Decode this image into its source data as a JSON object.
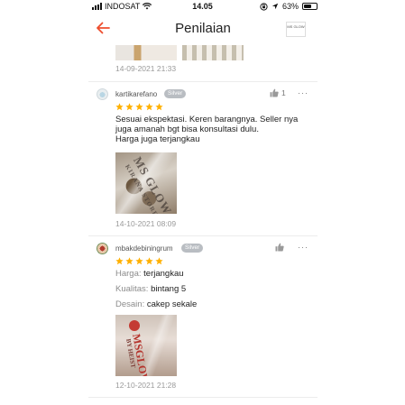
{
  "status_bar": {
    "carrier": "INDOSAT",
    "time": "14.05",
    "battery_text": "63%",
    "battery_level": 0.63
  },
  "header": {
    "title": "Penilaian",
    "shop_logo_text": "MS GLOW"
  },
  "colors": {
    "accent": "#ee4d2d",
    "star": "#ffb000",
    "tier_badge": "#b9bdc2"
  },
  "previous_review": {
    "date": "14-09-2021 21:33"
  },
  "reviews": [
    {
      "username": "kartikarefano",
      "tier": "Silver",
      "rating": 5,
      "likes": "1",
      "text_lines": [
        "Sesuai ekspektasi. Keren barangnya. Seller nya",
        "juga amanah bgt bisa konsultasi dulu.",
        "Harga juga terjangkau"
      ],
      "photo_text": "MS GLOW",
      "photo_subtext": "KIRANA STORE",
      "date": "14-10-2021 08:09"
    },
    {
      "username": "mbakdebiningrum",
      "tier": "Silver",
      "rating": 5,
      "attributes": [
        {
          "key": "Harga:",
          "value": "terjangkau"
        },
        {
          "key": "Kualitas:",
          "value": "bintang 5"
        },
        {
          "key": "Desain:",
          "value": "cakep sekale"
        }
      ],
      "photo_text": "MSGLOW",
      "photo_subtext": "BY HEIST",
      "date": "12-10-2021 21:28"
    }
  ]
}
